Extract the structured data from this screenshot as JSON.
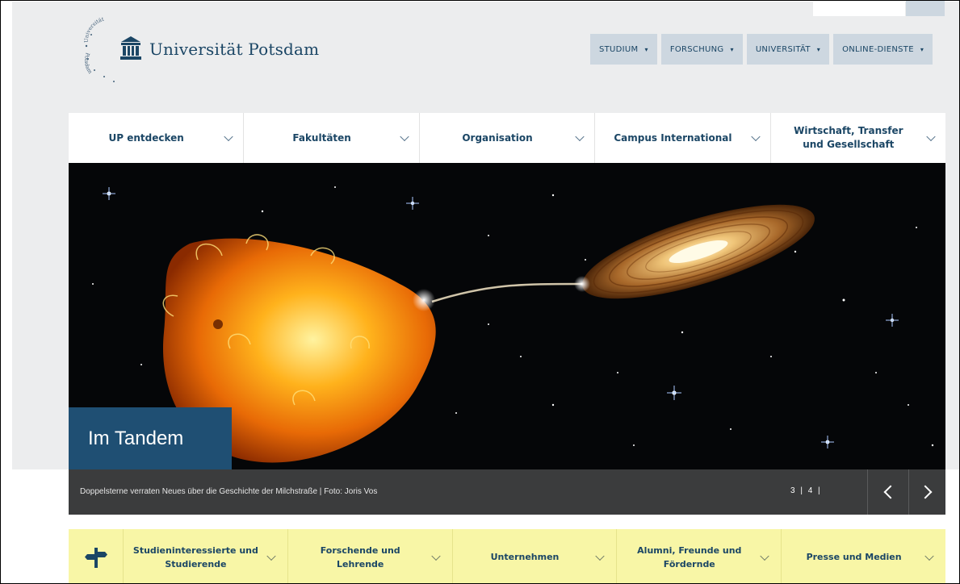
{
  "header": {
    "brand": "Universität Potsdam",
    "seal_text_top": "Universität",
    "seal_text_bottom": "Potsdam"
  },
  "top_nav": [
    {
      "label": "STUDIUM"
    },
    {
      "label": "FORSCHUNG"
    },
    {
      "label": "UNIVERSITÄT"
    },
    {
      "label": "ONLINE-DIENSTE"
    }
  ],
  "main_nav": [
    {
      "label": "UP entdecken"
    },
    {
      "label": "Fakultäten"
    },
    {
      "label": "Organisation"
    },
    {
      "label": "Campus International"
    },
    {
      "label": "Wirtschaft, Transfer und Gesellschaft"
    }
  ],
  "hero": {
    "title": "Im Tandem",
    "caption": "Doppelsterne verraten Neues über die Geschichte der Milchstraße | Foto: Joris Vos",
    "pager": "3 | 4 |"
  },
  "audience_nav": [
    {
      "label": "Studieninteressierte und Studierende"
    },
    {
      "label": "Forschende und Lehrende"
    },
    {
      "label": "Unternehmen"
    },
    {
      "label": "Alumni, Freunde und Fördernde"
    },
    {
      "label": "Presse und Medien"
    }
  ],
  "colors": {
    "brand_blue": "#1b4665",
    "topnav_bg": "#cdd7e0",
    "hero_title_bg": "#1f4f73",
    "caption_bar": "#3b3c3d",
    "audience_bar": "#f8f6a6"
  },
  "icons": {
    "logo": "university-building-icon",
    "signpost": "signpost-icon",
    "prev": "chevron-left-icon",
    "next": "chevron-right-icon",
    "dropdown": "chevron-down-icon"
  }
}
